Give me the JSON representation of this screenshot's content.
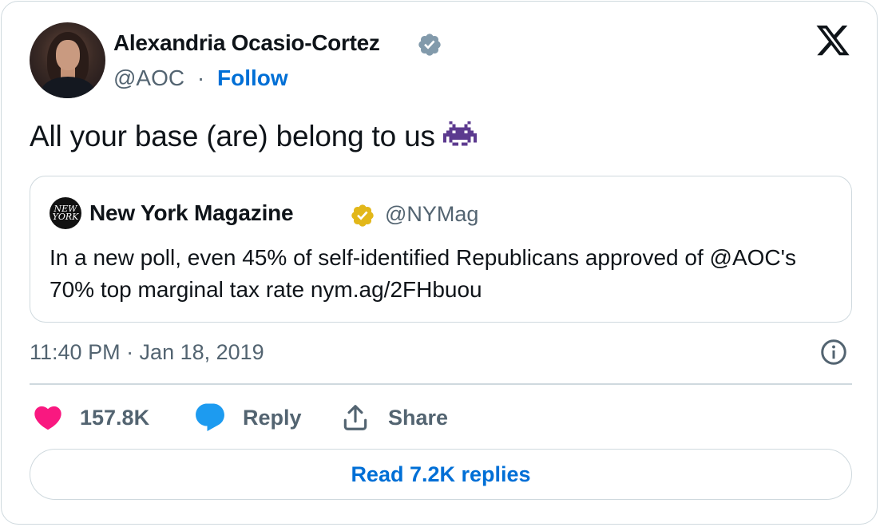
{
  "author": {
    "name": "Alexandria Ocasio-Cortez",
    "handle": "@AOC",
    "separator": "·",
    "follow_label": "Follow",
    "verified_color": "#829aab"
  },
  "tweet": {
    "text": "All your base (are) belong to us",
    "emoji": "alien-monster-icon",
    "timestamp": "11:40 PM · Jan 18, 2019"
  },
  "quoted": {
    "avatar_text": "NEW YORK",
    "name": "New York Magazine",
    "handle": "@NYMag",
    "text": "In a new poll, even 45% of self-identified Republicans approved of @AOC's 70% top marginal tax rate nym.ag/2FHbuou",
    "verified_color": "#e2b719"
  },
  "actions": {
    "like_count": "157.8K",
    "reply_label": "Reply",
    "share_label": "Share"
  },
  "read_replies_label": "Read 7.2K replies",
  "colors": {
    "link": "#006fd6",
    "muted": "#536471",
    "heart": "#f91880",
    "reply_bubble": "#1d9bf0",
    "border": "#cfd9de"
  }
}
